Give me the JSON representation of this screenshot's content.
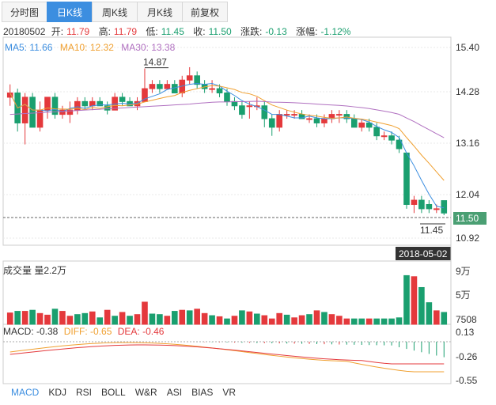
{
  "tabs": [
    {
      "label": "分时图",
      "active": false
    },
    {
      "label": "日K线",
      "active": true
    },
    {
      "label": "周K线",
      "active": false
    },
    {
      "label": "月K线",
      "active": false
    },
    {
      "label": "前复权",
      "active": false
    }
  ],
  "quote": {
    "date": "20180502",
    "open_label": "开:",
    "open": "11.79",
    "high_label": "高:",
    "high": "11.79",
    "low_label": "低:",
    "low": "11.45",
    "close_label": "收:",
    "close": "11.50",
    "change_label": "涨跌:",
    "change": "-0.13",
    "pct_label": "涨幅:",
    "pct": "-1.12%"
  },
  "ma_legend": {
    "ma5": "MA5: 11.66",
    "ma10": "MA10: 12.32",
    "ma30": "MA30: 13.38",
    "colors": {
      "ma5": "#3c8ee0",
      "ma10": "#f0a030",
      "ma30": "#b070c0"
    }
  },
  "volume_legend": "成交量 量2.2万",
  "macd_legend": {
    "macd": "MACD: -0.38",
    "diff": "DIFF: -0.65",
    "dea": "DEA: -0.46"
  },
  "bottom_tabs": [
    "MACD",
    "KDJ",
    "RSI",
    "BOLL",
    "W&R",
    "ASI",
    "BIAS",
    "VR"
  ],
  "colors": {
    "up": "#e4393c",
    "down": "#1a9f6f",
    "axis": "#999999",
    "grid": "#e8e8e8"
  },
  "chart_data": {
    "type": "candlestick",
    "price_axis": {
      "ticks": [
        "15.40",
        "14.28",
        "13.16",
        "12.04",
        "10.92"
      ],
      "ylim": [
        10.92,
        15.4
      ]
    },
    "current_price_label": "11.50",
    "max_marker": "14.87",
    "min_marker": "11.45",
    "date_marker": "2018-05-02",
    "candles": [
      [
        14.2,
        14.5,
        14.0,
        14.3
      ],
      [
        14.3,
        14.4,
        13.4,
        13.6
      ],
      [
        13.6,
        14.3,
        13.1,
        14.2
      ],
      [
        14.2,
        14.3,
        13.5,
        13.5
      ],
      [
        13.5,
        14.1,
        13.4,
        13.9
      ],
      [
        13.9,
        14.2,
        13.7,
        14.2
      ],
      [
        14.2,
        14.3,
        13.7,
        13.8
      ],
      [
        13.8,
        14.0,
        13.7,
        13.9
      ],
      [
        13.8,
        14.1,
        13.6,
        13.9
      ],
      [
        13.9,
        14.2,
        13.8,
        14.1
      ],
      [
        14.1,
        14.2,
        13.9,
        14.0
      ],
      [
        14.0,
        14.2,
        13.9,
        14.1
      ],
      [
        14.1,
        14.2,
        14.0,
        14.0
      ],
      [
        14.0,
        14.1,
        13.8,
        13.9
      ],
      [
        13.9,
        14.3,
        13.9,
        14.2
      ],
      [
        14.2,
        14.3,
        14.0,
        14.1
      ],
      [
        14.1,
        14.2,
        14.0,
        14.0
      ],
      [
        14.0,
        14.2,
        13.9,
        14.1
      ],
      [
        14.1,
        14.87,
        14.1,
        14.4
      ],
      [
        14.4,
        14.6,
        14.3,
        14.5
      ],
      [
        14.5,
        14.6,
        14.3,
        14.4
      ],
      [
        14.4,
        14.6,
        14.4,
        14.5
      ],
      [
        14.5,
        14.6,
        14.3,
        14.3
      ],
      [
        14.3,
        14.7,
        14.2,
        14.6
      ],
      [
        14.6,
        14.9,
        14.5,
        14.7
      ],
      [
        14.7,
        14.8,
        14.4,
        14.5
      ],
      [
        14.5,
        14.6,
        14.3,
        14.4
      ],
      [
        14.4,
        14.6,
        14.3,
        14.4
      ],
      [
        14.4,
        14.5,
        14.2,
        14.3
      ],
      [
        14.3,
        14.4,
        14.0,
        14.1
      ],
      [
        14.1,
        14.2,
        13.9,
        14.0
      ],
      [
        14.0,
        14.1,
        13.7,
        13.8
      ],
      [
        14.0,
        14.1,
        13.7,
        14.0
      ],
      [
        14.0,
        14.2,
        13.9,
        14.0
      ],
      [
        14.0,
        14.1,
        13.5,
        13.7
      ],
      [
        13.7,
        13.8,
        13.3,
        13.5
      ],
      [
        13.5,
        13.9,
        13.4,
        13.8
      ],
      [
        13.8,
        13.9,
        13.7,
        13.8
      ],
      [
        13.8,
        13.9,
        13.7,
        13.8
      ],
      [
        13.8,
        13.9,
        13.7,
        13.7
      ],
      [
        13.7,
        13.8,
        13.6,
        13.7
      ],
      [
        13.7,
        13.8,
        13.5,
        13.6
      ],
      [
        13.6,
        13.8,
        13.5,
        13.7
      ],
      [
        13.7,
        13.9,
        13.6,
        13.8
      ],
      [
        13.8,
        13.9,
        13.6,
        13.8
      ],
      [
        13.8,
        13.9,
        13.6,
        13.7
      ],
      [
        13.7,
        13.8,
        13.5,
        13.5
      ],
      [
        13.5,
        13.7,
        13.4,
        13.6
      ],
      [
        13.6,
        13.7,
        13.4,
        13.5
      ],
      [
        13.5,
        13.6,
        13.2,
        13.3
      ],
      [
        13.3,
        13.4,
        13.2,
        13.3
      ],
      [
        13.3,
        13.4,
        13.1,
        13.2
      ],
      [
        13.2,
        13.3,
        12.9,
        13.0
      ],
      [
        12.9,
        12.9,
        11.6,
        11.7
      ],
      [
        11.7,
        11.9,
        11.5,
        11.8
      ],
      [
        11.8,
        11.9,
        11.5,
        11.6
      ],
      [
        11.7,
        11.8,
        11.5,
        11.6
      ],
      [
        11.6,
        11.7,
        11.5,
        11.6
      ],
      [
        11.79,
        11.79,
        11.45,
        11.5
      ]
    ],
    "volume_axis": {
      "ticks": [
        "9万",
        "5万",
        "7508"
      ]
    },
    "volumes": [
      [
        2.1,
        1
      ],
      [
        2.4,
        0
      ],
      [
        2.4,
        1
      ],
      [
        2.6,
        0
      ],
      [
        2.0,
        1
      ],
      [
        1.7,
        1
      ],
      [
        2.8,
        0
      ],
      [
        2.4,
        1
      ],
      [
        1.5,
        1
      ],
      [
        1.8,
        0
      ],
      [
        2.0,
        0
      ],
      [
        2.3,
        1
      ],
      [
        1.2,
        0
      ],
      [
        2.6,
        1
      ],
      [
        1.5,
        0
      ],
      [
        2.2,
        1
      ],
      [
        1.5,
        0
      ],
      [
        1.8,
        1
      ],
      [
        4.1,
        1
      ],
      [
        1.9,
        0
      ],
      [
        1.8,
        0
      ],
      [
        1.5,
        1
      ],
      [
        2.4,
        0
      ],
      [
        2.6,
        1
      ],
      [
        2.5,
        0
      ],
      [
        2.8,
        1
      ],
      [
        2.0,
        1
      ],
      [
        1.6,
        0
      ],
      [
        1.4,
        1
      ],
      [
        1.0,
        0
      ],
      [
        1.5,
        1
      ],
      [
        2.5,
        0
      ],
      [
        2.3,
        1
      ],
      [
        1.9,
        0
      ],
      [
        1.6,
        1
      ],
      [
        1.0,
        1
      ],
      [
        2.0,
        1
      ],
      [
        1.7,
        0
      ],
      [
        1.2,
        1
      ],
      [
        1.6,
        1
      ],
      [
        1.8,
        0
      ],
      [
        2.5,
        1
      ],
      [
        2.2,
        0
      ],
      [
        1.8,
        1
      ],
      [
        1.5,
        1
      ],
      [
        1.0,
        1
      ],
      [
        1.0,
        0
      ],
      [
        1.0,
        0
      ],
      [
        1.0,
        1
      ],
      [
        1.0,
        0
      ],
      [
        1.0,
        0
      ],
      [
        1.0,
        0
      ],
      [
        1.2,
        0
      ],
      [
        9.0,
        0
      ],
      [
        8.8,
        1
      ],
      [
        6.8,
        0
      ],
      [
        4.0,
        0
      ],
      [
        2.5,
        1
      ],
      [
        2.2,
        0
      ]
    ],
    "macd_axis": {
      "ticks": [
        "0.13",
        "-0.26",
        "-0.55"
      ]
    }
  }
}
